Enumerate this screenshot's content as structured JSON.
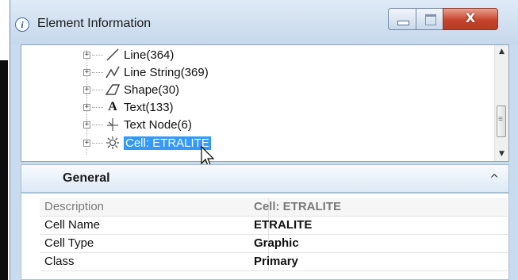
{
  "window": {
    "title": "Element Information",
    "info_glyph": "i",
    "close_glyph": "X"
  },
  "tree": {
    "items": [
      {
        "label": "Line(364)",
        "icon": "line-icon"
      },
      {
        "label": "Line String(369)",
        "icon": "line-string-icon"
      },
      {
        "label": "Shape(30)",
        "icon": "shape-icon"
      },
      {
        "label": "Text(133)",
        "icon": "text-icon",
        "glyph": "A"
      },
      {
        "label": "Text Node(6)",
        "icon": "text-node-icon"
      },
      {
        "label": "Cell: ETRALITE",
        "icon": "cell-icon",
        "selected": true
      }
    ],
    "expander_glyph": "+"
  },
  "panel": {
    "title": "General",
    "collapse_glyph": "^"
  },
  "properties": [
    {
      "key": "Description",
      "value": "Cell: ETRALITE",
      "readonly": true
    },
    {
      "key": "Cell Name",
      "value": "ETRALITE"
    },
    {
      "key": "Cell Type",
      "value": "Graphic"
    },
    {
      "key": "Class",
      "value": "Primary"
    }
  ],
  "colors": {
    "selection": "#3399ff",
    "window_frame": "#c9dcef",
    "close_button": "#c8442c"
  }
}
